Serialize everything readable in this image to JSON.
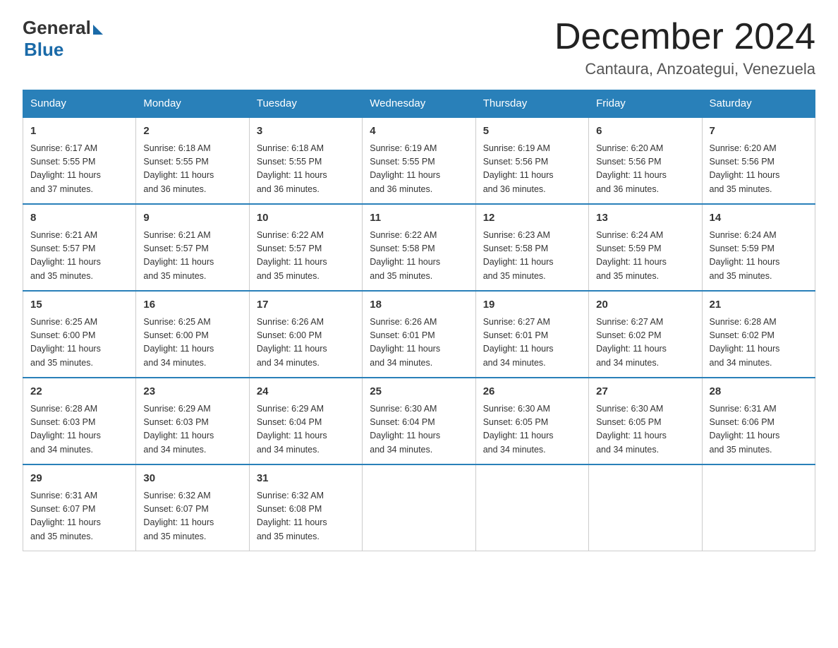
{
  "header": {
    "logo_general": "General",
    "logo_blue": "Blue",
    "month_title": "December 2024",
    "location": "Cantaura, Anzoategui, Venezuela"
  },
  "days_of_week": [
    "Sunday",
    "Monday",
    "Tuesday",
    "Wednesday",
    "Thursday",
    "Friday",
    "Saturday"
  ],
  "weeks": [
    [
      {
        "day": "1",
        "sunrise": "6:17 AM",
        "sunset": "5:55 PM",
        "daylight": "11 hours and 37 minutes."
      },
      {
        "day": "2",
        "sunrise": "6:18 AM",
        "sunset": "5:55 PM",
        "daylight": "11 hours and 36 minutes."
      },
      {
        "day": "3",
        "sunrise": "6:18 AM",
        "sunset": "5:55 PM",
        "daylight": "11 hours and 36 minutes."
      },
      {
        "day": "4",
        "sunrise": "6:19 AM",
        "sunset": "5:55 PM",
        "daylight": "11 hours and 36 minutes."
      },
      {
        "day": "5",
        "sunrise": "6:19 AM",
        "sunset": "5:56 PM",
        "daylight": "11 hours and 36 minutes."
      },
      {
        "day": "6",
        "sunrise": "6:20 AM",
        "sunset": "5:56 PM",
        "daylight": "11 hours and 36 minutes."
      },
      {
        "day": "7",
        "sunrise": "6:20 AM",
        "sunset": "5:56 PM",
        "daylight": "11 hours and 35 minutes."
      }
    ],
    [
      {
        "day": "8",
        "sunrise": "6:21 AM",
        "sunset": "5:57 PM",
        "daylight": "11 hours and 35 minutes."
      },
      {
        "day": "9",
        "sunrise": "6:21 AM",
        "sunset": "5:57 PM",
        "daylight": "11 hours and 35 minutes."
      },
      {
        "day": "10",
        "sunrise": "6:22 AM",
        "sunset": "5:57 PM",
        "daylight": "11 hours and 35 minutes."
      },
      {
        "day": "11",
        "sunrise": "6:22 AM",
        "sunset": "5:58 PM",
        "daylight": "11 hours and 35 minutes."
      },
      {
        "day": "12",
        "sunrise": "6:23 AM",
        "sunset": "5:58 PM",
        "daylight": "11 hours and 35 minutes."
      },
      {
        "day": "13",
        "sunrise": "6:24 AM",
        "sunset": "5:59 PM",
        "daylight": "11 hours and 35 minutes."
      },
      {
        "day": "14",
        "sunrise": "6:24 AM",
        "sunset": "5:59 PM",
        "daylight": "11 hours and 35 minutes."
      }
    ],
    [
      {
        "day": "15",
        "sunrise": "6:25 AM",
        "sunset": "6:00 PM",
        "daylight": "11 hours and 35 minutes."
      },
      {
        "day": "16",
        "sunrise": "6:25 AM",
        "sunset": "6:00 PM",
        "daylight": "11 hours and 34 minutes."
      },
      {
        "day": "17",
        "sunrise": "6:26 AM",
        "sunset": "6:00 PM",
        "daylight": "11 hours and 34 minutes."
      },
      {
        "day": "18",
        "sunrise": "6:26 AM",
        "sunset": "6:01 PM",
        "daylight": "11 hours and 34 minutes."
      },
      {
        "day": "19",
        "sunrise": "6:27 AM",
        "sunset": "6:01 PM",
        "daylight": "11 hours and 34 minutes."
      },
      {
        "day": "20",
        "sunrise": "6:27 AM",
        "sunset": "6:02 PM",
        "daylight": "11 hours and 34 minutes."
      },
      {
        "day": "21",
        "sunrise": "6:28 AM",
        "sunset": "6:02 PM",
        "daylight": "11 hours and 34 minutes."
      }
    ],
    [
      {
        "day": "22",
        "sunrise": "6:28 AM",
        "sunset": "6:03 PM",
        "daylight": "11 hours and 34 minutes."
      },
      {
        "day": "23",
        "sunrise": "6:29 AM",
        "sunset": "6:03 PM",
        "daylight": "11 hours and 34 minutes."
      },
      {
        "day": "24",
        "sunrise": "6:29 AM",
        "sunset": "6:04 PM",
        "daylight": "11 hours and 34 minutes."
      },
      {
        "day": "25",
        "sunrise": "6:30 AM",
        "sunset": "6:04 PM",
        "daylight": "11 hours and 34 minutes."
      },
      {
        "day": "26",
        "sunrise": "6:30 AM",
        "sunset": "6:05 PM",
        "daylight": "11 hours and 34 minutes."
      },
      {
        "day": "27",
        "sunrise": "6:30 AM",
        "sunset": "6:05 PM",
        "daylight": "11 hours and 34 minutes."
      },
      {
        "day": "28",
        "sunrise": "6:31 AM",
        "sunset": "6:06 PM",
        "daylight": "11 hours and 35 minutes."
      }
    ],
    [
      {
        "day": "29",
        "sunrise": "6:31 AM",
        "sunset": "6:07 PM",
        "daylight": "11 hours and 35 minutes."
      },
      {
        "day": "30",
        "sunrise": "6:32 AM",
        "sunset": "6:07 PM",
        "daylight": "11 hours and 35 minutes."
      },
      {
        "day": "31",
        "sunrise": "6:32 AM",
        "sunset": "6:08 PM",
        "daylight": "11 hours and 35 minutes."
      },
      null,
      null,
      null,
      null
    ]
  ],
  "labels": {
    "sunrise": "Sunrise:",
    "sunset": "Sunset:",
    "daylight": "Daylight:"
  },
  "accent_color": "#2980b9"
}
